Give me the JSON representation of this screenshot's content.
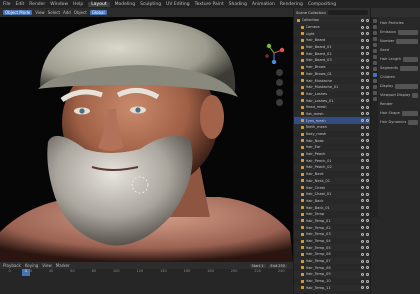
{
  "menu": [
    "File",
    "Edit",
    "Render",
    "Window",
    "Help"
  ],
  "workspace_tabs": [
    "Layout",
    "Modeling",
    "Sculpting",
    "UV Editing",
    "Texture Paint",
    "Shading",
    "Animation",
    "Rendering",
    "Compositing"
  ],
  "active_tab": "Layout",
  "viewport_header": [
    "Object Mode",
    "View",
    "Select",
    "Add",
    "Object",
    "Global"
  ],
  "timeline_header": [
    "Playback",
    "Keying",
    "View",
    "Marker"
  ],
  "timeline_ticks": [
    "0",
    "20",
    "40",
    "60",
    "80",
    "100",
    "120",
    "140",
    "160",
    "180",
    "200",
    "220",
    "240"
  ],
  "current_frame": "1",
  "frame_start": "Start 1",
  "frame_end": "End 250",
  "outliner": {
    "title": "Scene Collection",
    "rows": [
      "Collection",
      "Camera",
      "Light",
      "Hair_Beard",
      "Hair_Beard_01",
      "Hair_Beard_02",
      "Hair_Beard_03",
      "Hair_Brows",
      "Hair_Brows_01",
      "Hair_Mustache",
      "Hair_Mustache_01",
      "Hair_Lashes",
      "Hair_Lashes_01",
      "Head_mesh",
      "Hat_mesh",
      "Eyes_mesh",
      "Teeth_mesh",
      "Body_mesh",
      "Hair_Nose",
      "Hair_Ear",
      "Hair_Peach",
      "Hair_Peach_01",
      "Hair_Peach_02",
      "Hair_Neck",
      "Hair_Neck_01",
      "Hair_Chest",
      "Hair_Chest_01",
      "Hair_Back",
      "Hair_Back_01",
      "Hair_Temp",
      "Hair_Temp_01",
      "Hair_Temp_02",
      "Hair_Temp_03",
      "Hair_Temp_04",
      "Hair_Temp_05",
      "Hair_Temp_06",
      "Hair_Temp_07",
      "Hair_Temp_08",
      "Hair_Temp_09",
      "Hair_Temp_10",
      "Hair_Temp_11"
    ],
    "selected_index": 15
  },
  "properties": [
    "Hair Particles",
    "Emission",
    "Number",
    "Seed",
    "Hair Length",
    "Segments",
    "Children",
    "Display",
    "Viewport Display",
    "Render",
    "Hair Shape",
    "Hair Dynamics"
  ],
  "colors": {
    "accent": "#4772b3",
    "object_icon": "#d49a36"
  }
}
